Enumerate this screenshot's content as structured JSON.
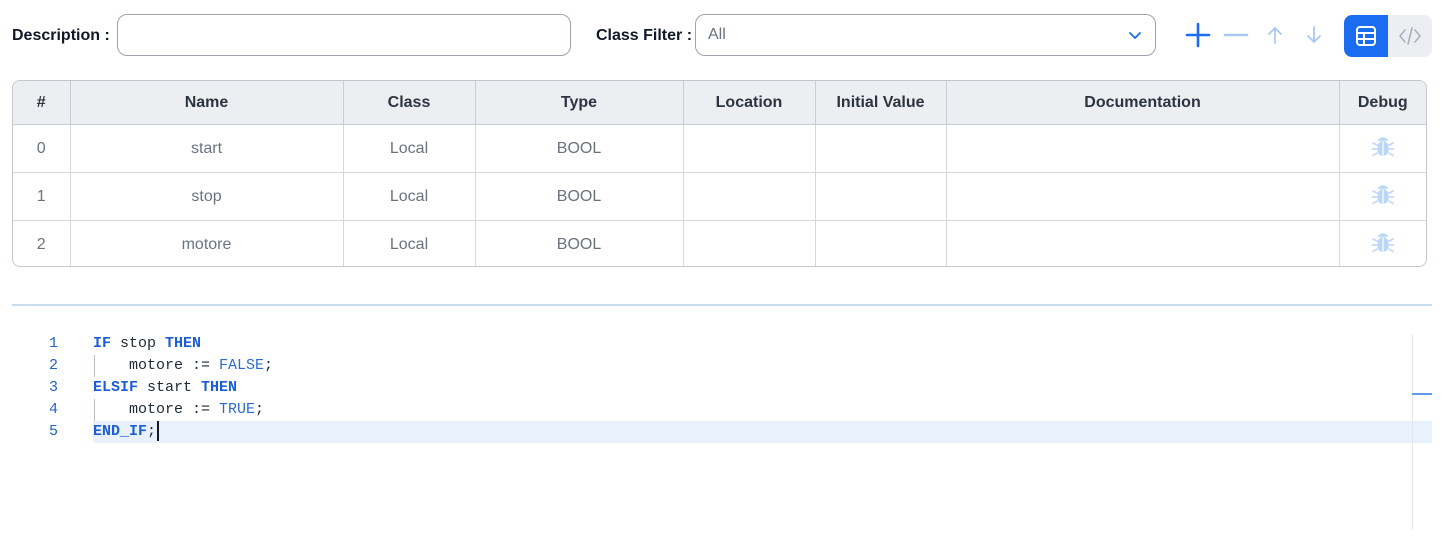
{
  "toolbar": {
    "description_label": "Description :",
    "description_value": "",
    "class_filter_label": "Class Filter :",
    "class_filter_value": "All",
    "add_icon": "plus-icon",
    "remove_icon": "minus-icon",
    "move_up_icon": "arrow-up-icon",
    "move_down_icon": "arrow-down-icon",
    "table_view_icon": "table-icon",
    "code_view_icon": "code-icon"
  },
  "colors": {
    "accent": "#1a6df0",
    "accent_light": "#a9c8f5",
    "header_bg": "#eceef2",
    "current_line": "#e8f1fc"
  },
  "table": {
    "columns": [
      "#",
      "Name",
      "Class",
      "Type",
      "Location",
      "Initial Value",
      "Documentation",
      "Debug"
    ],
    "rows": [
      {
        "index": "0",
        "name": "start",
        "class": "Local",
        "type": "BOOL",
        "location": "",
        "initial_value": "",
        "documentation": ""
      },
      {
        "index": "1",
        "name": "stop",
        "class": "Local",
        "type": "BOOL",
        "location": "",
        "initial_value": "",
        "documentation": ""
      },
      {
        "index": "2",
        "name": "motore",
        "class": "Local",
        "type": "BOOL",
        "location": "",
        "initial_value": "",
        "documentation": ""
      }
    ],
    "debug_icon": "bug-icon"
  },
  "editor": {
    "line_numbers": [
      "1",
      "2",
      "3",
      "4",
      "5"
    ],
    "tokens": {
      "l1_kw1": "IF",
      "l1_id": " stop ",
      "l1_kw2": "THEN",
      "l2_id": "    motore := ",
      "l2_lit": "FALSE",
      "l2_end": ";",
      "l3_kw1": "ELSIF",
      "l3_id": " start ",
      "l3_kw2": "THEN",
      "l4_id": "    motore := ",
      "l4_lit": "TRUE",
      "l4_end": ";",
      "l5_kw": "END_IF",
      "l5_end": ";"
    }
  }
}
